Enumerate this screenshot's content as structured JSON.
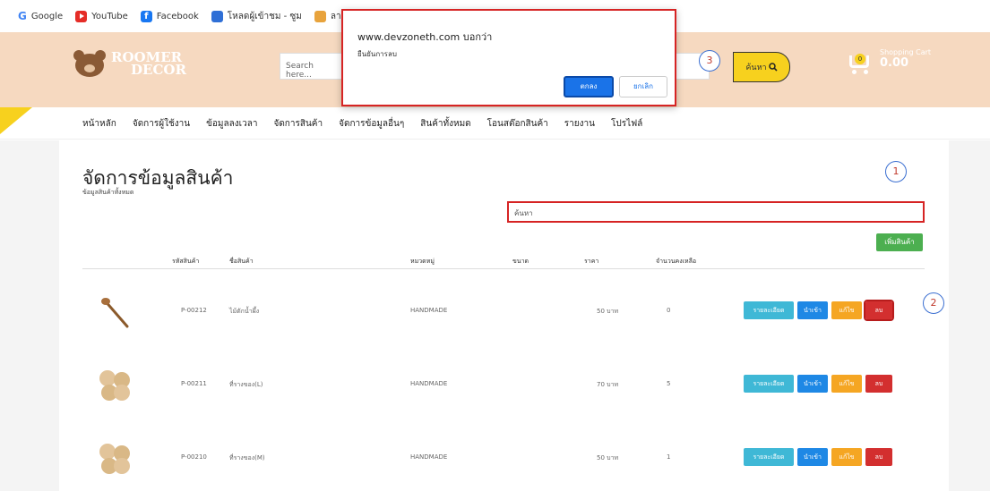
{
  "bookmarks": [
    {
      "label": "Google",
      "icon": "google-icon"
    },
    {
      "label": "YouTube",
      "icon": "youtube-icon"
    },
    {
      "label": "Facebook",
      "icon": "facebook-icon"
    },
    {
      "label": "โหลดผู้เข้าชม - ซูม",
      "icon": "site-icon"
    },
    {
      "label": "ลานน้ำ",
      "icon": "site-icon"
    }
  ],
  "header": {
    "logo_line1": "ROOMER",
    "logo_line2": "DECOR",
    "search_placeholder": "Search here...",
    "search_button": "ค้นหา",
    "cart_label": "Shopping Cart",
    "cart_total": "0.00",
    "cart_count": "0"
  },
  "nav": {
    "items": [
      "หน้าหลัก",
      "จัดการผู้ใช้งาน",
      "ข้อมูลลงเวลา",
      "จัดการสินค้า",
      "จัดการข้อมูลอื่นๆ",
      "สินค้าทั้งหมด",
      "โอนสต๊อกสินค้า",
      "รายงาน",
      "โปรไฟล์"
    ]
  },
  "page": {
    "title": "จัดการข้อมูลสินค้า",
    "subtitle": "ข้อมูลสินค้าทั้งหมด",
    "search_placeholder": "ค้นหา",
    "add_button": "เพิ่มสินค้า"
  },
  "table": {
    "columns": [
      "รหัสสินค้า",
      "ชื่อสินค้า",
      "หมวดหมู่",
      "ขนาด",
      "ราคา",
      "จำนวนคงเหลือ"
    ],
    "rows": [
      {
        "code": "P-00212",
        "name": "ไม้ตักน้ำผึ้ง",
        "category": "HANDMADE",
        "size": "",
        "price": "50 บาท",
        "stock": "0"
      },
      {
        "code": "P-00211",
        "name": "ที่รางของ(L)",
        "category": "HANDMADE",
        "size": "",
        "price": "70 บาท",
        "stock": "5"
      },
      {
        "code": "P-00210",
        "name": "ที่รางของ(M)",
        "category": "HANDMADE",
        "size": "",
        "price": "50 บาท",
        "stock": "1"
      }
    ],
    "actions": {
      "detail": "รายละเอียด",
      "import": "นำเข้า",
      "edit": "แก้ไข",
      "delete": "ลบ"
    }
  },
  "callouts": [
    "1",
    "2",
    "3"
  ],
  "dialog": {
    "title": "www.devzoneth.com บอกว่า",
    "message": "ยืนยันการลบ",
    "ok": "ตกลง",
    "cancel": "ยกเลิก"
  },
  "colors": {
    "header_bg": "#f6d9c0",
    "accent_yellow": "#f7d11e",
    "highlight_red": "#d62424",
    "btn_detail": "#3fb8d6",
    "btn_import": "#1e88e5",
    "btn_edit": "#f5a623",
    "btn_delete": "#d32f2f",
    "btn_add": "#4caf50"
  }
}
